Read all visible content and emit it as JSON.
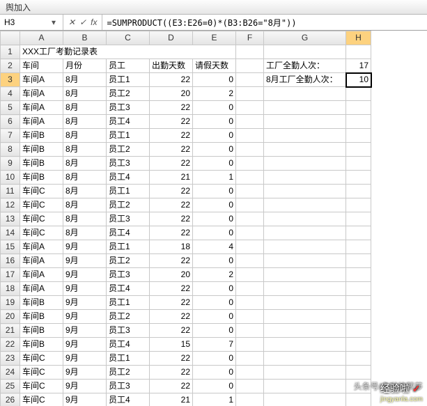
{
  "topbar": {
    "left_label": "舆加入"
  },
  "formula_bar": {
    "name_box": "H3",
    "dropdown_glyph": "▾",
    "cancel_glyph": "✕",
    "enter_glyph": "✓",
    "fx_label": "fx",
    "formula": "=SUMPRODUCT((E3:E26=0)*(B3:B26=\"8月\"))"
  },
  "columns": [
    "A",
    "B",
    "C",
    "D",
    "E",
    "F",
    "G",
    "H"
  ],
  "row_count": 26,
  "selected_cell": "H3",
  "title_row": {
    "text": "XXX工厂考勤记录表"
  },
  "header_row": {
    "A": "车间",
    "B": "月份",
    "C": "员工",
    "D": "出勤天数",
    "E": "请假天数"
  },
  "side_panel": {
    "label1": "工厂全勤人次：",
    "value1": 17,
    "label2": "8月工厂全勤人次：",
    "value2": 10
  },
  "data_rows": [
    {
      "A": "车间A",
      "B": "8月",
      "C": "员工1",
      "D": 22,
      "E": 0
    },
    {
      "A": "车间A",
      "B": "8月",
      "C": "员工2",
      "D": 20,
      "E": 2
    },
    {
      "A": "车间A",
      "B": "8月",
      "C": "员工3",
      "D": 22,
      "E": 0
    },
    {
      "A": "车间A",
      "B": "8月",
      "C": "员工4",
      "D": 22,
      "E": 0
    },
    {
      "A": "车间B",
      "B": "8月",
      "C": "员工1",
      "D": 22,
      "E": 0
    },
    {
      "A": "车间B",
      "B": "8月",
      "C": "员工2",
      "D": 22,
      "E": 0
    },
    {
      "A": "车间B",
      "B": "8月",
      "C": "员工3",
      "D": 22,
      "E": 0
    },
    {
      "A": "车间B",
      "B": "8月",
      "C": "员工4",
      "D": 21,
      "E": 1
    },
    {
      "A": "车间C",
      "B": "8月",
      "C": "员工1",
      "D": 22,
      "E": 0
    },
    {
      "A": "车间C",
      "B": "8月",
      "C": "员工2",
      "D": 22,
      "E": 0
    },
    {
      "A": "车间C",
      "B": "8月",
      "C": "员工3",
      "D": 22,
      "E": 0
    },
    {
      "A": "车间C",
      "B": "8月",
      "C": "员工4",
      "D": 22,
      "E": 0
    },
    {
      "A": "车间A",
      "B": "9月",
      "C": "员工1",
      "D": 18,
      "E": 4
    },
    {
      "A": "车间A",
      "B": "9月",
      "C": "员工2",
      "D": 22,
      "E": 0
    },
    {
      "A": "车间A",
      "B": "9月",
      "C": "员工3",
      "D": 20,
      "E": 2
    },
    {
      "A": "车间A",
      "B": "9月",
      "C": "员工4",
      "D": 22,
      "E": 0
    },
    {
      "A": "车间B",
      "B": "9月",
      "C": "员工1",
      "D": 22,
      "E": 0
    },
    {
      "A": "车间B",
      "B": "9月",
      "C": "员工2",
      "D": 22,
      "E": 0
    },
    {
      "A": "车间B",
      "B": "9月",
      "C": "员工3",
      "D": 22,
      "E": 0
    },
    {
      "A": "车间B",
      "B": "9月",
      "C": "员工4",
      "D": 15,
      "E": 7
    },
    {
      "A": "车间C",
      "B": "9月",
      "C": "员工1",
      "D": 22,
      "E": 0
    },
    {
      "A": "车间C",
      "B": "9月",
      "C": "员工2",
      "D": 22,
      "E": 0
    },
    {
      "A": "车间C",
      "B": "9月",
      "C": "员工3",
      "D": 22,
      "E": 0
    },
    {
      "A": "车间C",
      "B": "9月",
      "C": "员工4",
      "D": 21,
      "E": 1
    }
  ],
  "watermark": {
    "line1": "头条号/多啦的萝莎",
    "line2_a": "经验啦",
    "line2_b": "✓",
    "line3": "jingyanla.com"
  }
}
